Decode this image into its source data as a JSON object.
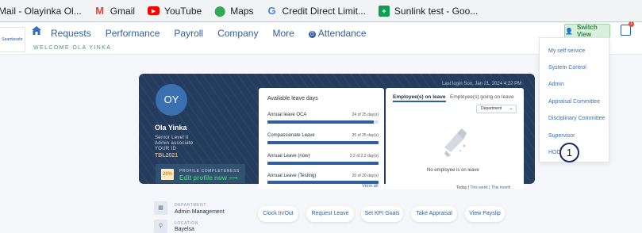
{
  "bookmarks": [
    {
      "label": "Mail - Olayinka Ol...",
      "icon": "mail-icon"
    },
    {
      "label": "Gmail",
      "icon": "gmail-icon"
    },
    {
      "label": "YouTube",
      "icon": "youtube-icon"
    },
    {
      "label": "Maps",
      "icon": "maps-icon"
    },
    {
      "label": "Credit Direct Limit...",
      "icon": "google-icon"
    },
    {
      "label": "Sunlink test - Goo...",
      "icon": "sheets-icon"
    }
  ],
  "nav": {
    "logo_text": "Seamlesshr",
    "links": [
      "Requests",
      "Performance",
      "Payroll",
      "Company",
      "More",
      "Attendance"
    ],
    "welcome": "WELCOME OLA YINKA",
    "switch_view": "Switch View",
    "notif_count": "1"
  },
  "dropdown": {
    "items": [
      "My self service",
      "System Control",
      "Admin",
      "Appraisal Committee",
      "Disciplinary Committee",
      "Supervisor",
      "HOD"
    ],
    "annotation": "1"
  },
  "profile": {
    "initials": "OY",
    "name": "Ola Yinka",
    "level": "Senior Level II",
    "title": "Admin associate",
    "id_label": "YOUR ID",
    "id": "TBL2021",
    "completeness_pct": "20%",
    "completeness_label": "PROFILE COMPLETENESS",
    "edit_link": "Edit profile now",
    "last_login": "Last login Sun, Jan 21, 2024 4:22 PM"
  },
  "leave": {
    "heading": "Available leave days",
    "rows": [
      {
        "name": "Annual leave OCA",
        "value": "24 of 25 day(s)",
        "fraction": 0.96
      },
      {
        "name": "Compassionate Leave",
        "value": "25 of 25 day(s)",
        "fraction": 1.0
      },
      {
        "name": "Annual Leave (now)",
        "value": "2.2 of 2.2 day(s)",
        "fraction": 1.0
      },
      {
        "name": "Annual Leave (Testing)",
        "value": "20 of 20 day(s)",
        "fraction": 1.0
      }
    ],
    "view_all": "View all"
  },
  "employees": {
    "tab_on_leave": "Employee(s) on leave",
    "tab_going": "Employee(s) going on leave",
    "department": "Department",
    "empty_text": "No employee is on leave",
    "period_today": "Today",
    "period_week": "This week",
    "period_month": "This month"
  },
  "info": {
    "department_label": "DEPARTMENT",
    "department": "Admin Management",
    "location_label": "LOCATION",
    "location": "Bayelsa"
  },
  "actions": [
    "Clock In/Out",
    "Request Leave",
    "Set KPI Goals",
    "Take Appraisal",
    "View Payslip"
  ]
}
